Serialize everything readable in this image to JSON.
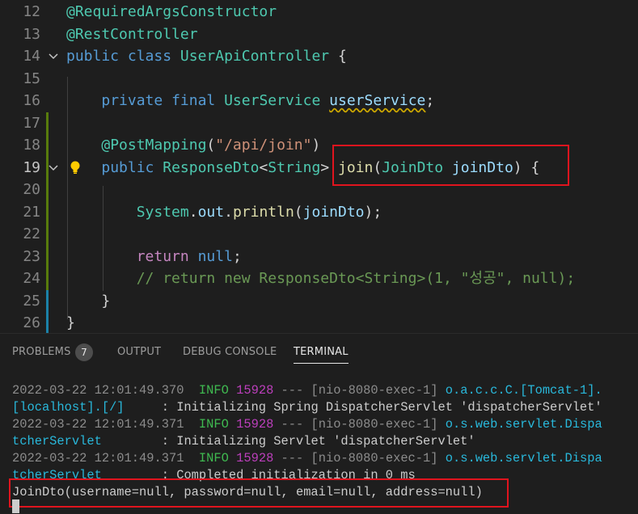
{
  "editor": {
    "lines": [
      {
        "num": "12",
        "tokens": [
          {
            "t": "@RequiredArgsConstructor",
            "c": "a"
          }
        ]
      },
      {
        "num": "13",
        "tokens": [
          {
            "t": "@RestController",
            "c": "a"
          }
        ]
      },
      {
        "num": "14",
        "tokens": [
          {
            "t": "public",
            "c": "k"
          },
          {
            "t": " "
          },
          {
            "t": "class",
            "c": "k"
          },
          {
            "t": " "
          },
          {
            "t": "UserApiController",
            "c": "t"
          },
          {
            "t": " {",
            "c": "p"
          }
        ]
      },
      {
        "num": "15",
        "tokens": []
      },
      {
        "num": "16",
        "tokens": [
          {
            "t": "    "
          },
          {
            "t": "private",
            "c": "k"
          },
          {
            "t": " "
          },
          {
            "t": "final",
            "c": "k"
          },
          {
            "t": " "
          },
          {
            "t": "UserService",
            "c": "t"
          },
          {
            "t": " "
          },
          {
            "t": "userService",
            "c": "v",
            "squig": true
          },
          {
            "t": ";",
            "c": "p"
          }
        ]
      },
      {
        "num": "17",
        "tokens": []
      },
      {
        "num": "18",
        "tokens": [
          {
            "t": "    "
          },
          {
            "t": "@PostMapping",
            "c": "a"
          },
          {
            "t": "(",
            "c": "p"
          },
          {
            "t": "\"/api/join\"",
            "c": "s"
          },
          {
            "t": ")",
            "c": "p"
          }
        ]
      },
      {
        "num": "19",
        "tokens": [
          {
            "t": "    "
          },
          {
            "t": "public",
            "c": "k"
          },
          {
            "t": " "
          },
          {
            "t": "ResponseDto",
            "c": "t"
          },
          {
            "t": "<",
            "c": "p"
          },
          {
            "t": "String",
            "c": "t"
          },
          {
            "t": ">",
            "c": "p"
          },
          {
            "t": " "
          },
          {
            "t": "join",
            "c": "f"
          },
          {
            "t": "(",
            "c": "p"
          },
          {
            "t": "JoinDto",
            "c": "t"
          },
          {
            "t": " "
          },
          {
            "t": "joinDto",
            "c": "v"
          },
          {
            "t": ") {",
            "c": "p"
          }
        ]
      },
      {
        "num": "20",
        "tokens": []
      },
      {
        "num": "21",
        "tokens": [
          {
            "t": "        "
          },
          {
            "t": "System",
            "c": "t"
          },
          {
            "t": ".",
            "c": "p"
          },
          {
            "t": "out",
            "c": "v"
          },
          {
            "t": ".",
            "c": "p"
          },
          {
            "t": "println",
            "c": "f"
          },
          {
            "t": "(",
            "c": "p"
          },
          {
            "t": "joinDto",
            "c": "v"
          },
          {
            "t": ");",
            "c": "p"
          }
        ]
      },
      {
        "num": "22",
        "tokens": []
      },
      {
        "num": "23",
        "tokens": [
          {
            "t": "        "
          },
          {
            "t": "return",
            "c": "r"
          },
          {
            "t": " "
          },
          {
            "t": "null",
            "c": "k"
          },
          {
            "t": ";",
            "c": "p"
          }
        ]
      },
      {
        "num": "24",
        "tokens": [
          {
            "t": "        "
          },
          {
            "t": "// return new ResponseDto<String>(1, \"성공\", null);",
            "c": "c"
          }
        ]
      },
      {
        "num": "25",
        "tokens": [
          {
            "t": "    }",
            "c": "p"
          }
        ]
      },
      {
        "num": "26",
        "tokens": [
          {
            "t": "}",
            "c": "p"
          }
        ]
      }
    ]
  },
  "panel": {
    "tabs": {
      "problems": "PROBLEMS",
      "problems_count": "7",
      "output": "OUTPUT",
      "debug_console": "DEBUG CONSOLE",
      "terminal": "TERMINAL"
    },
    "terminal": [
      [
        {
          "t": "2022-03-22 12:01:49.370",
          "c": "ts"
        },
        {
          "t": "  "
        },
        {
          "t": "INFO",
          "c": "ti"
        },
        {
          "t": " "
        },
        {
          "t": "15928",
          "c": "tp"
        },
        {
          "t": " --- [nio-8080-exec-1] ",
          "c": "tsep"
        },
        {
          "t": "o.a.c.c.C.[Tomcat-1].",
          "c": "tc"
        }
      ],
      [
        {
          "t": "[localhost].[/]",
          "c": "tc"
        },
        {
          "t": "     : Initializing Spring DispatcherServlet 'dispatcherServlet'"
        }
      ],
      [
        {
          "t": "2022-03-22 12:01:49.371",
          "c": "ts"
        },
        {
          "t": "  "
        },
        {
          "t": "INFO",
          "c": "ti"
        },
        {
          "t": " "
        },
        {
          "t": "15928",
          "c": "tp"
        },
        {
          "t": " --- [nio-8080-exec-1] ",
          "c": "tsep"
        },
        {
          "t": "o.s.web.servlet.Dispa",
          "c": "tc"
        }
      ],
      [
        {
          "t": "tcherServlet",
          "c": "tc"
        },
        {
          "t": "        : Initializing Servlet 'dispatcherServlet'"
        }
      ],
      [
        {
          "t": "2022-03-22 12:01:49.371",
          "c": "ts"
        },
        {
          "t": "  "
        },
        {
          "t": "INFO",
          "c": "ti"
        },
        {
          "t": " "
        },
        {
          "t": "15928",
          "c": "tp"
        },
        {
          "t": " --- [nio-8080-exec-1] ",
          "c": "tsep"
        },
        {
          "t": "o.s.web.servlet.Dispa",
          "c": "tc"
        }
      ],
      [
        {
          "t": "tcherServlet",
          "c": "tc"
        },
        {
          "t": "        : Completed initialization in 0 ms"
        }
      ],
      [
        {
          "t": "JoinDto(username=null, password=null, email=null, address=null)"
        }
      ]
    ]
  },
  "colors": {
    "highlight_box": "#e0141e",
    "background": "#1e1e1e"
  }
}
